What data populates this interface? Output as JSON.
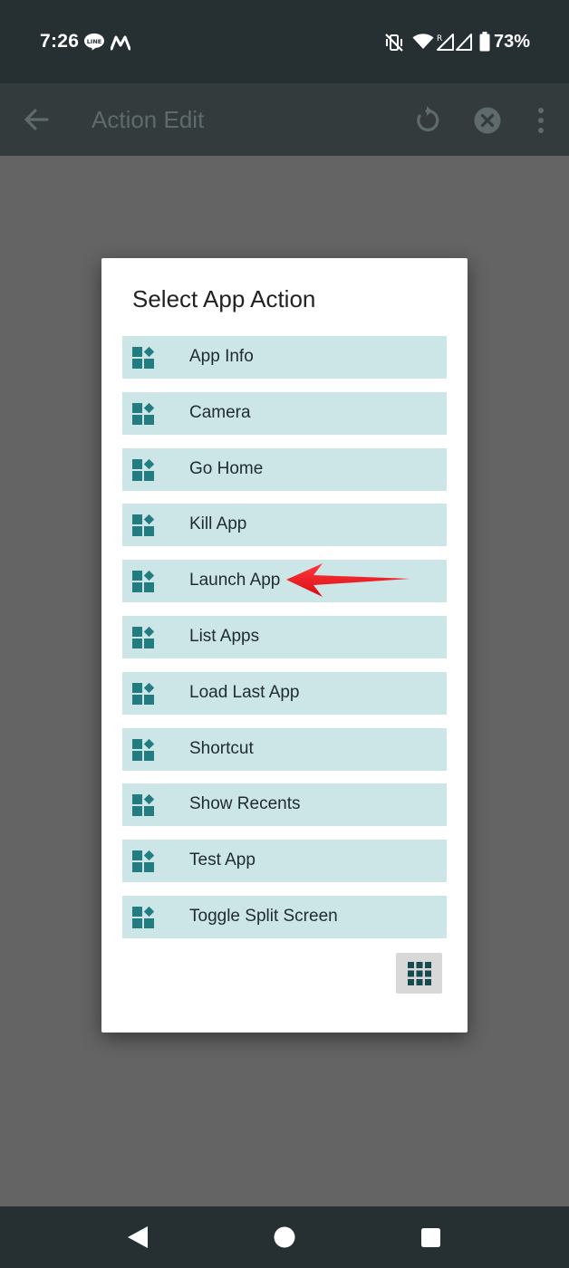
{
  "status_bar": {
    "time": "7:26",
    "battery": "73%",
    "signal_roaming": "R",
    "icons": [
      "line-app-icon",
      "m-app-icon",
      "vibrate-mute-icon",
      "wifi-icon",
      "signal-icon",
      "signal-icon",
      "battery-icon"
    ]
  },
  "app_bar": {
    "title": "Action Edit",
    "icons": [
      "back-arrow-icon",
      "reset-icon",
      "close-circle-icon",
      "more-vert-icon"
    ]
  },
  "dialog": {
    "title": "Select App Action",
    "items": [
      {
        "label": "App Info"
      },
      {
        "label": "Camera"
      },
      {
        "label": "Go Home"
      },
      {
        "label": "Kill App"
      },
      {
        "label": "Launch App"
      },
      {
        "label": "List Apps"
      },
      {
        "label": "Load Last App"
      },
      {
        "label": "Shortcut"
      },
      {
        "label": "Show Recents"
      },
      {
        "label": "Test App"
      },
      {
        "label": "Toggle Split Screen"
      }
    ],
    "item_icon": "widgets-icon",
    "grid_button_icon": "grid-icon"
  },
  "annotation": {
    "arrow_color": "#f0131a",
    "points_to": "Launch App"
  },
  "colors": {
    "status_bar": "#263033",
    "app_bar": "#333b3d",
    "overlay": "#646464",
    "item_background": "#cce6e8",
    "icon_teal": "#227c80",
    "grid_icon": "#174a50"
  },
  "nav_bar": {
    "icons": [
      "nav-back-icon",
      "nav-home-icon",
      "nav-recents-icon"
    ]
  }
}
